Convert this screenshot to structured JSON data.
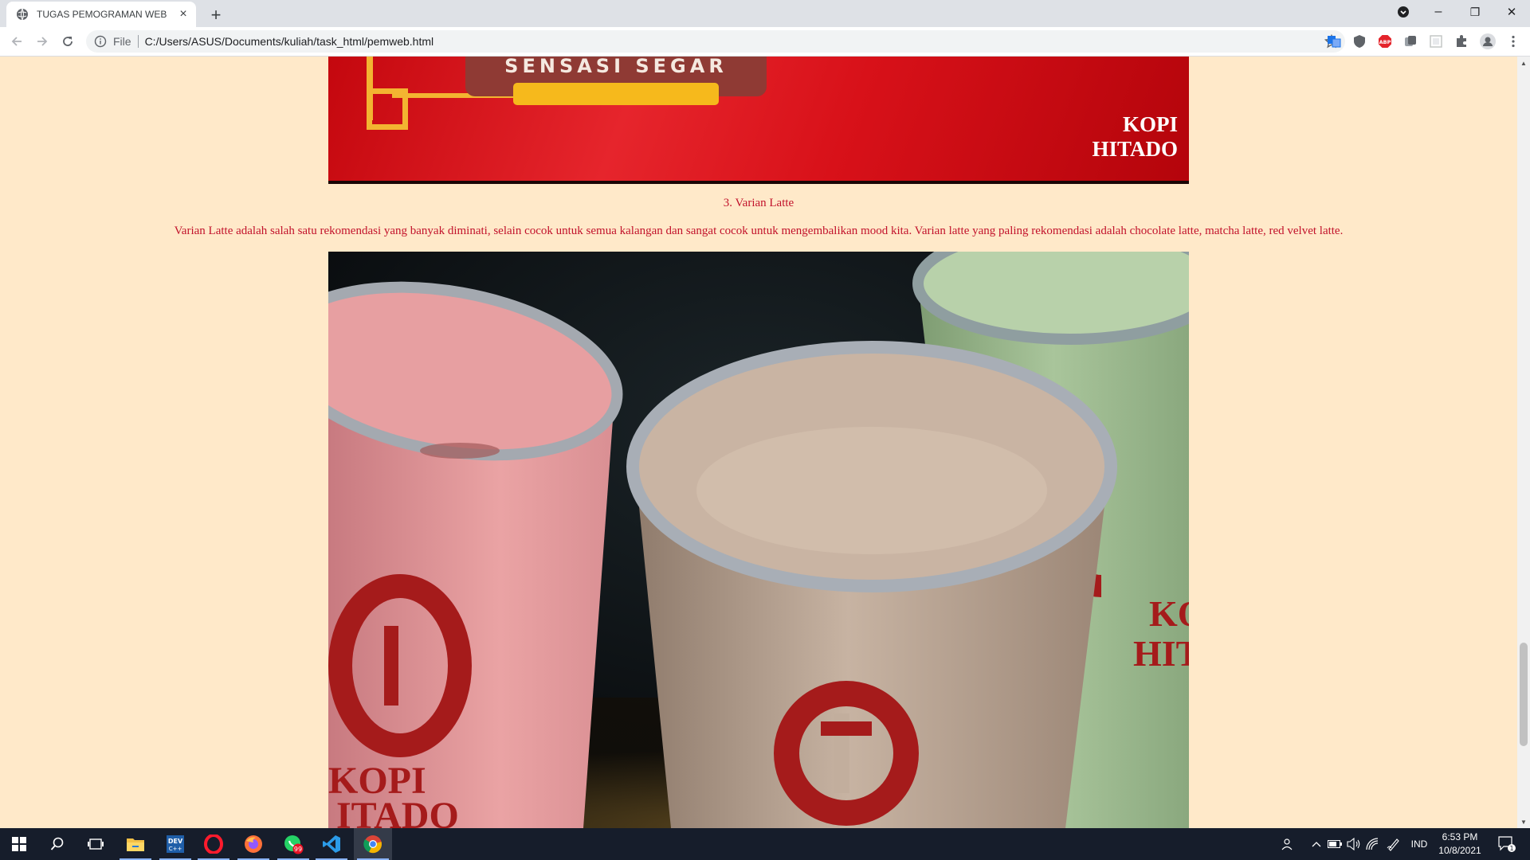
{
  "browser": {
    "tab_title": "TUGAS PEMOGRAMAN WEB",
    "tab_close": "×",
    "new_tab": "+",
    "scheme_label": "File",
    "url": "C:/Users/ASUS/Documents/kuliah/task_html/pemweb.html",
    "window_controls": {
      "minimize": "–",
      "restore": "❐",
      "close": "✕"
    }
  },
  "page": {
    "banner": {
      "plate_text": "SENSASI SEGAR",
      "brand_line1": "KOPI",
      "brand_line2": "HITADO"
    },
    "section_heading": "3. Varian Latte",
    "section_text": "Varian Latte adalah salah satu rekomendasi yang banyak diminati, selain cocok untuk semua kalangan dan sangat cocok untuk mengembalikan mood kita. Varian latte yang paling rekomendasi adalah chocolate latte, matcha latte, red velvet latte.",
    "photo": {
      "cup_left_text_1": "KOPI",
      "cup_left_text_2": "ITADO",
      "cup_right_text_1": "KO",
      "cup_right_text_2": "HIT"
    }
  },
  "taskbar": {
    "whatsapp_badge": "99",
    "language": "IND",
    "time": "6:53 PM",
    "date": "10/8/2021",
    "notification_count": "1"
  },
  "colors": {
    "page_background": "#ffe9c9",
    "text_accent": "#c2122b",
    "banner_red": "#d81119",
    "banner_gold": "#f6b91c"
  }
}
